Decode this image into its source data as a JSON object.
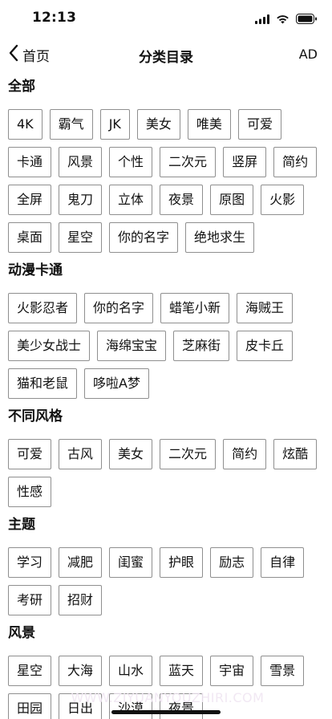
{
  "status": {
    "time": "12:13",
    "icons": [
      "signal-icon",
      "wifi-icon",
      "battery-icon"
    ]
  },
  "nav": {
    "back_label": "首页",
    "title": "分类目录",
    "right_label": "AD"
  },
  "sections": [
    {
      "title": "全部",
      "tags": [
        "4K",
        "霸气",
        "JK",
        "美女",
        "唯美",
        "可爱",
        "卡通",
        "风景",
        "个性",
        "二次元",
        "竖屏",
        "简约",
        "全屏",
        "鬼刀",
        "立体",
        "夜景",
        "原图",
        "火影",
        "桌面",
        "星空",
        "你的名字",
        "绝地求生"
      ]
    },
    {
      "title": "动漫卡通",
      "tags": [
        "火影忍者",
        "你的名字",
        "蜡笔小新",
        "海贼王",
        "美少女战士",
        "海绵宝宝",
        "芝麻街",
        "皮卡丘",
        "猫和老鼠",
        "哆啦A梦"
      ]
    },
    {
      "title": "不同风格",
      "tags": [
        "可爱",
        "古风",
        "美女",
        "二次元",
        "简约",
        "炫酷",
        "性感"
      ]
    },
    {
      "title": "主题",
      "tags": [
        "学习",
        "减肥",
        "闺蜜",
        "护眼",
        "励志",
        "自律",
        "考研",
        "招财"
      ]
    },
    {
      "title": "风景",
      "tags": [
        "星空",
        "大海",
        "山水",
        "蓝天",
        "宇宙",
        "雪景",
        "田园",
        "日出",
        "沙漠",
        "夜景"
      ]
    }
  ],
  "watermark": "WWW.ZIYUANYOUZHIRI.COM",
  "colors": {
    "tag_border": "#8f8f8f",
    "text": "#111111",
    "background": "#ffffff"
  }
}
